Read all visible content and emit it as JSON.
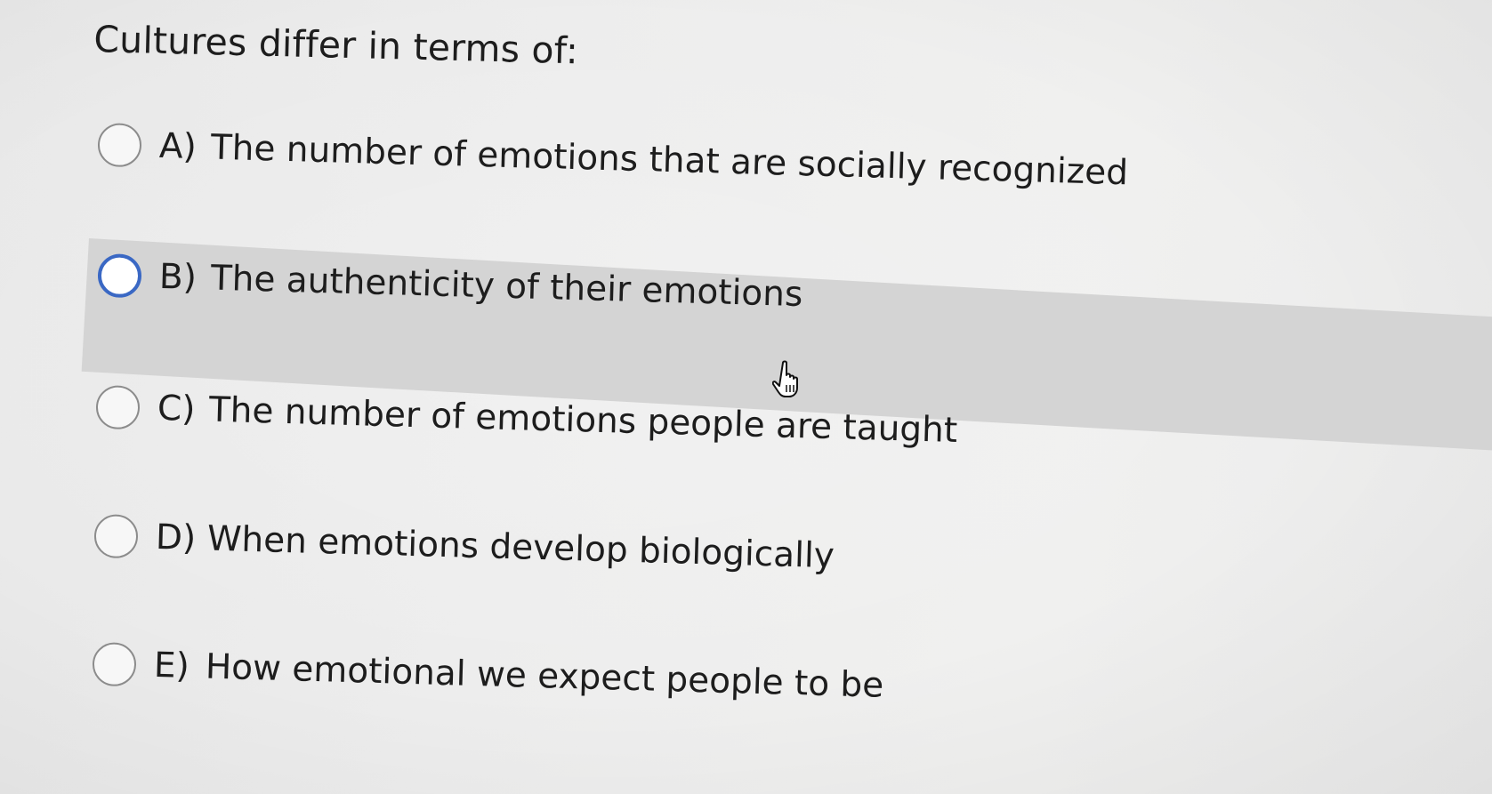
{
  "question": {
    "text": "Cultures differ in terms of:"
  },
  "options": [
    {
      "letter": "A)",
      "text": "The number of emotions that are socially recognized",
      "state": "unselected"
    },
    {
      "letter": "B)",
      "text": "The authenticity of their emotions",
      "state": "hovered"
    },
    {
      "letter": "C)",
      "text": "The number of emotions people are taught",
      "state": "unselected"
    },
    {
      "letter": "D)",
      "text": "When emotions develop biologically",
      "state": "unselected"
    },
    {
      "letter": "E)",
      "text": "How emotional we expect people to be",
      "state": "unselected"
    }
  ],
  "colors": {
    "hover_row": "#d4d4d4",
    "radio_hover_border": "#3a68c4",
    "radio_border": "#8c8c8c",
    "text": "#1d1d1d"
  },
  "icons": {
    "cursor": "hand-pointer-icon"
  }
}
